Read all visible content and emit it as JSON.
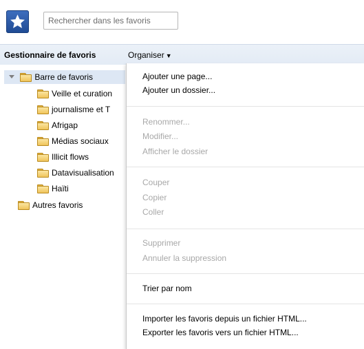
{
  "header": {
    "search_placeholder": "Rechercher dans les favoris"
  },
  "toolbar": {
    "title": "Gestionnaire de favoris",
    "organize": "Organiser"
  },
  "tree": {
    "root": "Barre de favoris",
    "children": [
      "Veille et curation",
      "journalisme et T",
      "Afrigap",
      "Médias sociaux",
      "Illicit flows",
      "Datavisualisation",
      "Haïti"
    ],
    "other": "Autres favoris"
  },
  "menu": {
    "add_page": "Ajouter une page...",
    "add_folder": "Ajouter un dossier...",
    "rename": "Renommer...",
    "edit": "Modifier...",
    "show_folder": "Afficher le dossier",
    "cut": "Couper",
    "copy": "Copier",
    "paste": "Coller",
    "delete": "Supprimer",
    "undo_delete": "Annuler la suppression",
    "sort": "Trier par nom",
    "import": "Importer les favoris depuis un fichier HTML...",
    "export": "Exporter les favoris vers un fichier HTML..."
  }
}
